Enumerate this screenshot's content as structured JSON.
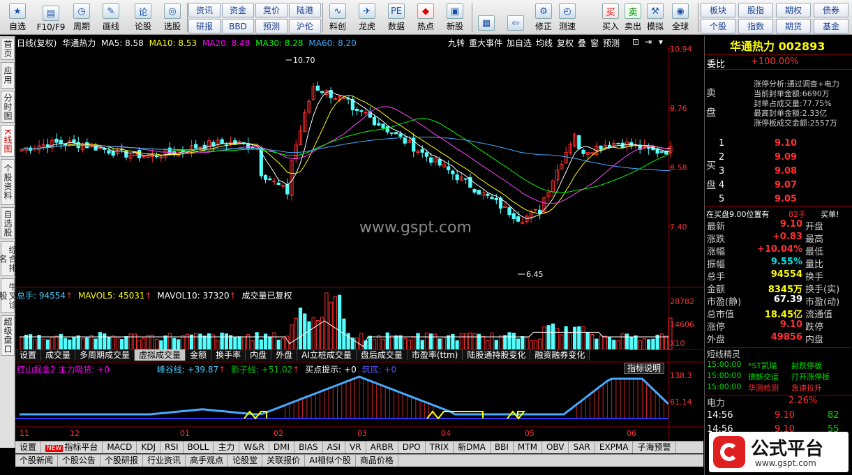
{
  "toolbar": {
    "left_buttons": [
      {
        "label": "自选",
        "icon": "star-icon"
      },
      {
        "label": "F10/F9",
        "icon": "f10-icon"
      },
      {
        "label": "周期",
        "icon": "clock-icon"
      },
      {
        "label": "画线",
        "icon": "pen-icon"
      },
      {
        "label": "论股",
        "icon": "discuss-icon"
      },
      {
        "label": "选股",
        "icon": "select-stock-icon"
      }
    ],
    "text_buttons": [
      [
        "资讯",
        "资金",
        "竞价",
        "陆港"
      ],
      [
        "研报",
        "BBD",
        "预测",
        "沪伦"
      ]
    ],
    "mid_buttons": [
      {
        "label": "料创",
        "icon": "chart-icon"
      },
      {
        "label": "龙虎",
        "icon": "dragon-icon"
      },
      {
        "label": "数据",
        "icon": "pe-icon"
      },
      {
        "label": "热点",
        "icon": "hot-icon"
      },
      {
        "label": "新股",
        "icon": "ipo-icon"
      }
    ],
    "right_buttons": [
      {
        "label": "",
        "icon": "color-grid-icon"
      },
      {
        "label": "",
        "icon": "back-arrow-icon"
      },
      {
        "label": "修正",
        "icon": "adjust-icon"
      },
      {
        "label": "测速",
        "icon": "speed-icon"
      },
      {
        "label": "买入",
        "icon": "buy-icon"
      },
      {
        "label": "卖出",
        "icon": "sell-icon"
      },
      {
        "label": "模拟",
        "icon": "hammer-icon"
      },
      {
        "label": "全球",
        "icon": "globe-icon"
      }
    ],
    "far_right": [
      [
        "板块",
        "股指",
        "期权",
        "债券"
      ],
      [
        "个股",
        "指数",
        "期货",
        "基金"
      ]
    ]
  },
  "leftnav": [
    {
      "label": "首页",
      "active": false
    },
    {
      "label": "应用",
      "active": false
    },
    {
      "label": "分时图",
      "active": false
    },
    {
      "label": "K线图",
      "active": true
    },
    {
      "label": "个股资料",
      "active": false
    },
    {
      "label": "自选股",
      "active": false
    },
    {
      "label": "综合排名",
      "active": false
    },
    {
      "label": "牛叉诊股",
      "active": false
    },
    {
      "label": "超级盘口",
      "active": false
    }
  ],
  "chart_header": {
    "period": "日线(复权)",
    "name": "华通热力",
    "ma5": "MA5: 8.58",
    "ma10": "MA10: 8.53",
    "ma20": "MA20: 8.48",
    "ma30": "MA30: 8.28",
    "ma60": "MA60: 8.20",
    "buttons": [
      "九转",
      "重大事件",
      "加自选",
      "均线",
      "复权",
      "叠",
      "窗",
      "预测"
    ]
  },
  "price_axis": [
    "10.94",
    "9.76",
    "8.58",
    "7.40"
  ],
  "annotations": {
    "high": "10.70",
    "low": "6.45"
  },
  "volume_header": {
    "total": "总手: 94554",
    "mavol5": "MAVOL5: 45031",
    "mavol10": "MAVOL10: 37320",
    "note": "成交量已复权"
  },
  "volume_axis": [
    "28782",
    "14606",
    "X10"
  ],
  "indicator_tabs": [
    {
      "label": "设置",
      "on": false
    },
    {
      "label": "成交量",
      "on": false
    },
    {
      "label": "多周期成交量",
      "on": false
    },
    {
      "label": "虚拟成交量",
      "on": true
    },
    {
      "label": "金额",
      "on": false
    },
    {
      "label": "换手率",
      "on": false
    },
    {
      "label": "内盘",
      "on": false
    },
    {
      "label": "外盘",
      "on": false
    },
    {
      "label": "AI立桩成交量",
      "on": false
    },
    {
      "label": "盘后成交量",
      "on": false
    },
    {
      "label": "市盈率(ttm)",
      "on": false
    },
    {
      "label": "陆股通持股变化",
      "on": false
    },
    {
      "label": "融资融券变化",
      "on": false
    }
  ],
  "indicator_note": "指标说明",
  "indicator_header": {
    "name": "红山掘金2 主力吸货: +0",
    "valley": "峰谷线: +39.87",
    "shadow": "影子线: +51.02",
    "buy": "买点提示: +0",
    "other": "筑底: +0"
  },
  "indicator_axis": [
    "138.3",
    "61.14"
  ],
  "time_axis": [
    "11",
    "12",
    "01",
    "02",
    "03",
    "04",
    "05",
    "06"
  ],
  "watermark": "www.gspt.com",
  "bottom_tabs1": [
    "设置",
    "指标平台",
    "MACD",
    "KDJ",
    "RSI",
    "BOLL",
    "主力",
    "W&R",
    "DMI",
    "BIAS",
    "ASI",
    "VR",
    "ARBR",
    "DPO",
    "TRIX",
    "新DMA",
    "BBI",
    "MTM",
    "OBV",
    "SAR",
    "EXPMA",
    "子海预警"
  ],
  "bottom_tabs2": [
    "个股新闻",
    "个股公告",
    "个股研报",
    "行业资讯",
    "高手观点",
    "论股堂",
    "关联报价",
    "AI相似个股",
    "商品价格"
  ],
  "right_panel": {
    "title": "华通热力 002893",
    "weibi_label": "委比",
    "weibi_value": "+100.00%",
    "sell_label": "卖盘",
    "buy_label": "买盘",
    "limit_info": [
      "涨停分析:通过调查+电力",
      "当前封单金额:6690万",
      "封单占成交量:77.75%",
      "最高封单金额:2.33亿",
      "涨停板成交金额:2557万"
    ],
    "buy_levels": [
      {
        "n": "1",
        "p": "9.10"
      },
      {
        "n": "2",
        "p": "9.09"
      },
      {
        "n": "3",
        "p": "9.08"
      },
      {
        "n": "4",
        "p": "9.07"
      },
      {
        "n": "5",
        "p": "9.05"
      }
    ],
    "notice": "在买盘9.00位置有",
    "notice_qty": "82手",
    "notice_tag": "买单!",
    "quotes": [
      {
        "l1": "最新",
        "v1": "9.10",
        "l2": "开盘",
        "c": "red"
      },
      {
        "l1": "涨跌",
        "v1": "+0.83",
        "l2": "最高",
        "c": "red"
      },
      {
        "l1": "涨幅",
        "v1": "+10.04%",
        "l2": "最低",
        "c": "red"
      },
      {
        "l1": "振幅",
        "v1": "9.55%",
        "l2": "量比",
        "c": "cyan"
      },
      {
        "l1": "总手",
        "v1": "94554",
        "l2": "换手",
        "c": "yel"
      },
      {
        "l1": "金额",
        "v1": "8345万",
        "l2": "换手(实)",
        "c": "yel"
      },
      {
        "l1": "市盈(静)",
        "v1": "67.39",
        "l2": "市盈(动)",
        "c": "wht"
      },
      {
        "l1": "总市值",
        "v1": "18.45亿",
        "l2": "流通值",
        "c": "yel"
      },
      {
        "l1": "涨停",
        "v1": "9.10",
        "l2": "跌停",
        "c": "red"
      },
      {
        "l1": "外盘",
        "v1": "49856",
        "l2": "内盘",
        "c": "red"
      }
    ],
    "short_title": "短线精灵",
    "short_items": [
      {
        "t": "15:00:00",
        "s": "*ST凯瑞",
        "e": "封跌停板"
      },
      {
        "t": "15:00:00",
        "s": "德新交运",
        "e": "打开涨停板"
      },
      {
        "t": "15:00:00",
        "s": "华测检测",
        "e": "急速拉升"
      }
    ],
    "power_label": "电力",
    "power_value": "2.26%",
    "ticks": [
      {
        "t": "14:56",
        "p": "9.10",
        "v": "82"
      },
      {
        "t": "14:56",
        "p": "9.10",
        "v": "55"
      }
    ]
  },
  "logo": {
    "text": "公式平台",
    "url": "www.gspt.com"
  }
}
